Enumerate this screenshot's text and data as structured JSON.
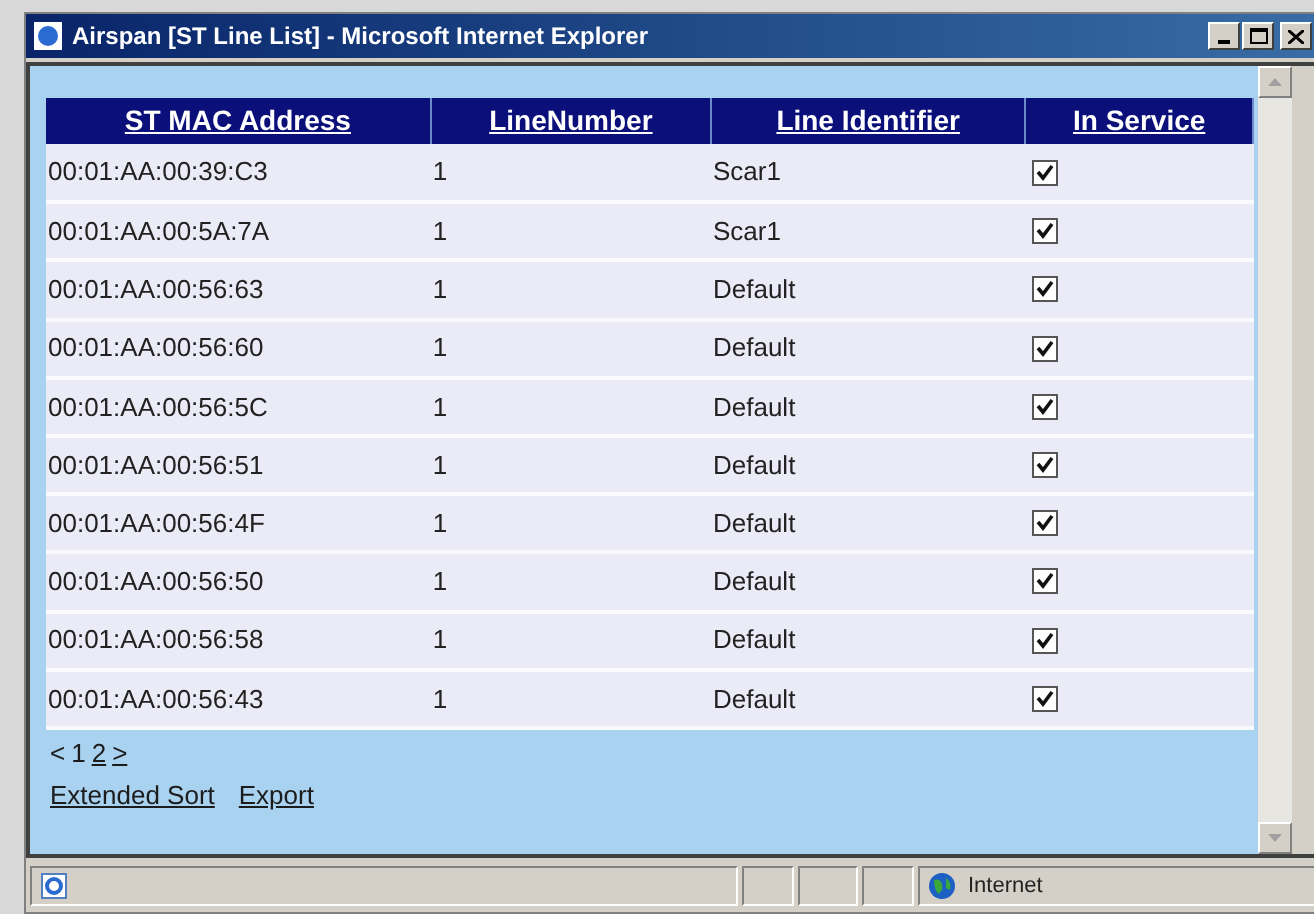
{
  "window": {
    "title": "Airspan [ST Line List] - Microsoft Internet Explorer"
  },
  "table": {
    "columns": [
      "ST MAC Address",
      "LineNumber",
      "Line Identifier",
      "In Service"
    ],
    "rows": [
      {
        "mac": "00:01:AA:00:39:C3",
        "line_number": "1",
        "line_identifier": "Scar1",
        "in_service": true
      },
      {
        "mac": "00:01:AA:00:5A:7A",
        "line_number": "1",
        "line_identifier": "Scar1",
        "in_service": true
      },
      {
        "mac": "00:01:AA:00:56:63",
        "line_number": "1",
        "line_identifier": "Default",
        "in_service": true
      },
      {
        "mac": "00:01:AA:00:56:60",
        "line_number": "1",
        "line_identifier": "Default",
        "in_service": true
      },
      {
        "mac": "00:01:AA:00:56:5C",
        "line_number": "1",
        "line_identifier": "Default",
        "in_service": true
      },
      {
        "mac": "00:01:AA:00:56:51",
        "line_number": "1",
        "line_identifier": "Default",
        "in_service": true
      },
      {
        "mac": "00:01:AA:00:56:4F",
        "line_number": "1",
        "line_identifier": "Default",
        "in_service": true
      },
      {
        "mac": "00:01:AA:00:56:50",
        "line_number": "1",
        "line_identifier": "Default",
        "in_service": true
      },
      {
        "mac": "00:01:AA:00:56:58",
        "line_number": "1",
        "line_identifier": "Default",
        "in_service": true
      },
      {
        "mac": "00:01:AA:00:56:43",
        "line_number": "1",
        "line_identifier": "Default",
        "in_service": true
      }
    ]
  },
  "pagination": [
    {
      "label": "<",
      "kind": "arrow"
    },
    {
      "label": "1",
      "kind": "current"
    },
    {
      "label": "2",
      "kind": "link"
    },
    {
      "label": ">",
      "kind": "link"
    }
  ],
  "links": [
    "Extended Sort",
    "Export"
  ],
  "status_bar": {
    "zone": "Internet"
  }
}
